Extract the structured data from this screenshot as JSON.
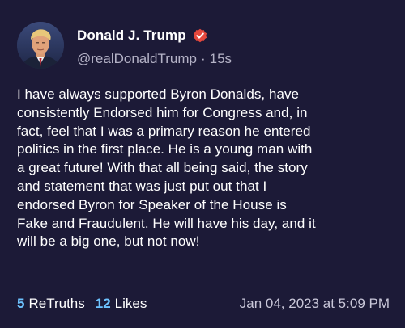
{
  "post": {
    "author_name": "Donald J. Trump",
    "handle": "@realDonaldTrump",
    "separator": "·",
    "relative_time": "15s",
    "text": "I have always supported Byron Donalds, have\nconsistently Endorsed him for Congress and, in\nfact, feel that I was a primary reason he entered\npolitics in the first place. He is a young man with\na great future! With that all being said, the story\nand statement that was just put out that I\nendorsed Byron for Speaker of the House is\nFake and Fraudulent. He will have his day, and it\nwill be a big one, but not now!",
    "retruths_count": "5",
    "retruths_label": "ReTruths",
    "likes_count": "12",
    "likes_label": "Likes",
    "timestamp": "Jan 04, 2023 at 5:09 PM"
  },
  "icons": {
    "verified": "verified-badge-icon",
    "avatar": "profile-photo"
  },
  "colors": {
    "background": "#1c1a37",
    "verified_badge": "#e6483d",
    "stat_count": "#6dc3ff",
    "handle": "#b4b2c6"
  }
}
